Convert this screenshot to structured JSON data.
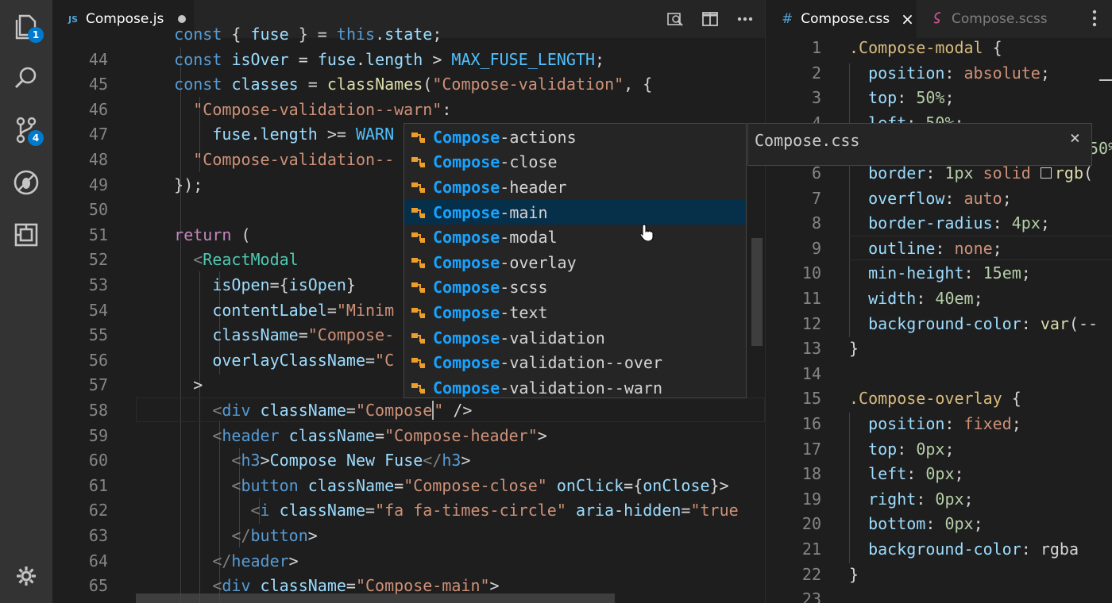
{
  "activity_bar": {
    "explorer_badge": "1",
    "scm_badge": "4"
  },
  "left_editor": {
    "tab_label": "Compose.js",
    "tab_type": "JS",
    "lines": [
      {
        "n": "",
        "text": "    const { fuse } = this.state;"
      },
      {
        "n": "44",
        "text": "    const isOver = fuse.length > MAX_FUSE_LENGTH;"
      },
      {
        "n": "45",
        "text": "    const classes = classNames(\"Compose-validation\", {"
      },
      {
        "n": "46",
        "text": "      \"Compose-validation--warn\":"
      },
      {
        "n": "47",
        "text": "        fuse.length >= WARN"
      },
      {
        "n": "48",
        "text": "      \"Compose-validation--"
      },
      {
        "n": "49",
        "text": "    });"
      },
      {
        "n": "50",
        "text": ""
      },
      {
        "n": "51",
        "text": "    return ("
      },
      {
        "n": "52",
        "text": "      <ReactModal"
      },
      {
        "n": "53",
        "text": "        isOpen={isOpen}"
      },
      {
        "n": "54",
        "text": "        contentLabel=\"Minim"
      },
      {
        "n": "55",
        "text": "        className=\"Compose-"
      },
      {
        "n": "56",
        "text": "        overlayClassName=\"C"
      },
      {
        "n": "57",
        "text": "      >"
      },
      {
        "n": "58",
        "text": "        <div className=\"Compose\" />"
      },
      {
        "n": "59",
        "text": "        <header className=\"Compose-header\">"
      },
      {
        "n": "60",
        "text": "          <h3>Compose New Fuse</h3>"
      },
      {
        "n": "61",
        "text": "          <button className=\"Compose-close\" onClick={onClose}>"
      },
      {
        "n": "62",
        "text": "            <i className=\"fa fa-times-circle\" aria-hidden=\"true"
      },
      {
        "n": "63",
        "text": "          </button>"
      },
      {
        "n": "64",
        "text": "        </header>"
      },
      {
        "n": "65",
        "text": "        <div className=\"Compose-main\">"
      }
    ]
  },
  "suggest": {
    "prefix": "Compose",
    "items": [
      {
        "rest": "-actions",
        "selected": false
      },
      {
        "rest": "-close",
        "selected": false
      },
      {
        "rest": "-header",
        "selected": false
      },
      {
        "rest": "-main",
        "selected": true
      },
      {
        "rest": "-modal",
        "selected": false
      },
      {
        "rest": "-overlay",
        "selected": false
      },
      {
        "rest": "-scss",
        "selected": false
      },
      {
        "rest": "-text",
        "selected": false
      },
      {
        "rest": "-validation",
        "selected": false
      },
      {
        "rest": "-validation--over",
        "selected": false
      },
      {
        "rest": "-validation--warn",
        "selected": false
      }
    ],
    "details_title": "Compose.css",
    "details_close": "×"
  },
  "right_editor": {
    "tab_active": "Compose.css",
    "tab_active_type": "#",
    "tab_close": "×",
    "tab_inactive": "Compose.scss",
    "lines": [
      {
        "n": "1",
        "text": ".Compose-modal {"
      },
      {
        "n": "2",
        "text": "  position: absolute;"
      },
      {
        "n": "3",
        "text": "  top: 50%;"
      },
      {
        "n": "4",
        "text": "  left: 50%;"
      },
      {
        "n": "5",
        "text": ""
      },
      {
        "n": "6",
        "text": "  border: 1px solid rgb("
      },
      {
        "n": "7",
        "text": "  overflow: auto;"
      },
      {
        "n": "8",
        "text": "  border-radius: 4px;"
      },
      {
        "n": "9",
        "text": "  outline: none;"
      },
      {
        "n": "10",
        "text": "  min-height: 15em;"
      },
      {
        "n": "11",
        "text": "  width: 40em;"
      },
      {
        "n": "12",
        "text": "  background-color: var(--"
      },
      {
        "n": "13",
        "text": "}"
      },
      {
        "n": "14",
        "text": ""
      },
      {
        "n": "15",
        "text": ".Compose-overlay {"
      },
      {
        "n": "16",
        "text": "  position: fixed;"
      },
      {
        "n": "17",
        "text": "  top: 0px;"
      },
      {
        "n": "18",
        "text": "  left: 0px;"
      },
      {
        "n": "19",
        "text": "  right: 0px;"
      },
      {
        "n": "20",
        "text": "  bottom: 0px;"
      },
      {
        "n": "21",
        "text": "  background-color: rgba"
      },
      {
        "n": "22",
        "text": "}"
      },
      {
        "n": "23",
        "text": ""
      }
    ],
    "partial_value": "50%"
  },
  "colors": {
    "activity_bg": "#333333",
    "editor_bg": "#1e1e1e",
    "accent": "#007acc",
    "suggest_highlight": "#18a3ff",
    "suggest_selected_bg": "#062f4a"
  }
}
